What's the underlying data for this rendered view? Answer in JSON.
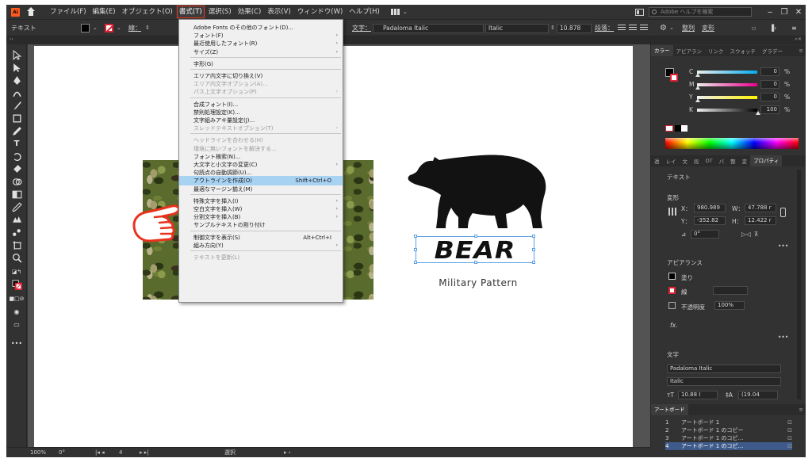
{
  "app": {
    "logo": "Ai"
  },
  "menubar": {
    "items": [
      "ファイル(F)",
      "編集(E)",
      "オブジェクト(O)",
      "書式(T)",
      "選択(S)",
      "効果(C)",
      "表示(V)",
      "ウィンドウ(W)",
      "ヘルプ(H)"
    ],
    "active_index": 3,
    "help_placeholder": "Adobe ヘルプを検索",
    "window_buttons": [
      "‒",
      "❐",
      "✕"
    ]
  },
  "controlbar": {
    "context_label": "テキスト",
    "stroke_label": "線：",
    "char_label": "文字：",
    "font_family": "Padaloma Italic",
    "font_style": "Italic",
    "font_size": "10.878",
    "paragraph_label": "段落：",
    "arrange_label": "整列",
    "transform_label": "変形"
  },
  "dropdown": {
    "items": [
      {
        "label": "Adobe Fonts のその他のフォント(D)...",
        "disabled": false,
        "submenu": false,
        "shortcut": ""
      },
      {
        "label": "フォント(F)",
        "disabled": false,
        "submenu": true,
        "shortcut": ""
      },
      {
        "label": "最近使用したフォント(R)",
        "disabled": false,
        "submenu": true,
        "shortcut": ""
      },
      {
        "label": "サイズ(Z)",
        "disabled": false,
        "submenu": true,
        "shortcut": ""
      },
      {
        "sep": true
      },
      {
        "label": "字形(G)",
        "disabled": false,
        "submenu": false,
        "shortcut": ""
      },
      {
        "sep": true
      },
      {
        "label": "エリア内文字に切り換え(V)",
        "disabled": false,
        "submenu": false,
        "shortcut": ""
      },
      {
        "label": "エリア内文字オプション(A)...",
        "disabled": true,
        "submenu": false,
        "shortcut": ""
      },
      {
        "label": "パス上文字オプション(P)",
        "disabled": true,
        "submenu": true,
        "shortcut": ""
      },
      {
        "sep": true
      },
      {
        "label": "合成フォント(I)...",
        "disabled": false,
        "submenu": false,
        "shortcut": ""
      },
      {
        "label": "禁則処理設定(K)...",
        "disabled": false,
        "submenu": false,
        "shortcut": ""
      },
      {
        "label": "文字組みアキ量設定(J)...",
        "disabled": false,
        "submenu": false,
        "shortcut": ""
      },
      {
        "label": "スレッドテキストオプション(T)",
        "disabled": true,
        "submenu": true,
        "shortcut": ""
      },
      {
        "sep": true
      },
      {
        "label": "ヘッドラインを合わせる(H)",
        "disabled": true,
        "submenu": false,
        "shortcut": ""
      },
      {
        "label": "環境に無いフォントを解決する...",
        "disabled": true,
        "submenu": false,
        "shortcut": ""
      },
      {
        "label": "フォント検索(N)...",
        "disabled": false,
        "submenu": false,
        "shortcut": ""
      },
      {
        "label": "大文字と小文字の変更(C)",
        "disabled": false,
        "submenu": true,
        "shortcut": ""
      },
      {
        "label": "句読点の自動調節(U)...",
        "disabled": false,
        "submenu": false,
        "shortcut": ""
      },
      {
        "label": "アウトラインを作成(O)",
        "disabled": false,
        "submenu": false,
        "shortcut": "Shift+Ctrl+O",
        "highlight": true
      },
      {
        "label": "最適なマージン揃え(M)",
        "disabled": false,
        "submenu": false,
        "shortcut": ""
      },
      {
        "sep": true
      },
      {
        "label": "特殊文字を挿入(I)",
        "disabled": false,
        "submenu": true,
        "shortcut": ""
      },
      {
        "label": "空白文字を挿入(W)",
        "disabled": false,
        "submenu": true,
        "shortcut": ""
      },
      {
        "label": "分割文字を挿入(B)",
        "disabled": false,
        "submenu": true,
        "shortcut": ""
      },
      {
        "label": "サンプルテキストの割り付け",
        "disabled": false,
        "submenu": false,
        "shortcut": ""
      },
      {
        "sep": true
      },
      {
        "label": "制御文字を表示(S)",
        "disabled": false,
        "submenu": false,
        "shortcut": "Alt+Ctrl+I"
      },
      {
        "label": "組み方向(Y)",
        "disabled": false,
        "submenu": true,
        "shortcut": ""
      },
      {
        "sep": true
      },
      {
        "label": "テキストを更新(L)",
        "disabled": true,
        "submenu": false,
        "shortcut": ""
      }
    ]
  },
  "artboard": {
    "logo_text": "BEAR",
    "subtitle": "Military Pattern"
  },
  "color_panel": {
    "tabs": [
      "カラー",
      "アピアラン",
      "リンク",
      "スウォッチ",
      "グラデー"
    ],
    "channels": [
      {
        "name": "C",
        "value": "0",
        "unit": "%",
        "level": 0
      },
      {
        "name": "M",
        "value": "0",
        "unit": "%",
        "level": 0
      },
      {
        "name": "Y",
        "value": "0",
        "unit": "%",
        "level": 0
      },
      {
        "name": "K",
        "value": "100",
        "unit": "%",
        "level": 1
      }
    ]
  },
  "properties_panel": {
    "tabs": [
      "透",
      "レイ",
      "文",
      "段",
      "OT",
      "パ",
      "整",
      "変",
      "プロパティ"
    ],
    "section_text": "テキスト",
    "transform_title": "変形",
    "x_label": "X：",
    "x_value": "980.989",
    "y_label": "Y：",
    "y_value": "-352.82",
    "w_label": "W：",
    "w_value": "47.788 r",
    "h_label": "H：",
    "h_value": "12.422 r",
    "angle_value": "0°",
    "more": "•••",
    "appearance_title": "アピアランス",
    "fill_label": "塗り",
    "stroke_label": "線",
    "opacity_label": "不透明度",
    "opacity_value": "100%",
    "fx_label": "fx.",
    "char_title": "文字",
    "font_family": "Padaloma Italic",
    "font_style": "Italic",
    "font_size": "10.88 I",
    "leading": "(19.04"
  },
  "artboards_panel": {
    "title": "アートボード",
    "rows": [
      {
        "num": "1",
        "name": "アートボード 1"
      },
      {
        "num": "2",
        "name": "アートボード 1 のコピー"
      },
      {
        "num": "3",
        "name": "アートボード 1 のコピ…"
      },
      {
        "num": "4",
        "name": "アートボード 1 のコピ…"
      }
    ]
  },
  "statusbar": {
    "zoom": "100%",
    "rotation": "0°",
    "page": "4",
    "tool": "選択"
  }
}
